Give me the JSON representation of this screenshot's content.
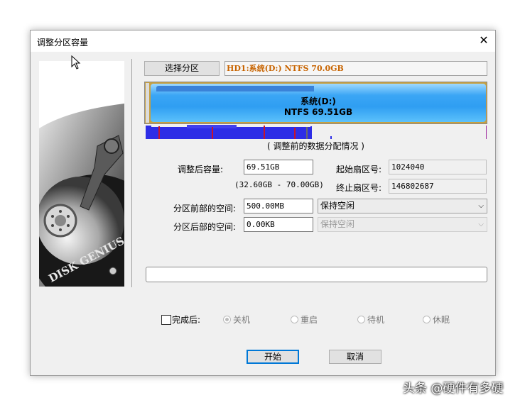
{
  "dialog": {
    "title": "调整分区容量",
    "close_glyph": "✕"
  },
  "side_panel": {
    "logo_text": "DISK GENIUS"
  },
  "partition": {
    "select_button": "选择分区",
    "info": "HD1:系统(D:) NTFS 70.0GB",
    "bar_line1": "系统(D:)",
    "bar_line2": "NTFS 69.51GB",
    "bar_color": "#3ba6f5",
    "distribution_caption": "( 调整前的数据分配情况 )",
    "distribution_color": "#2d2de6"
  },
  "form": {
    "new_size_label": "调整后容量:",
    "new_size_value": "69.51GB",
    "range_text": "(32.60GB - 70.00GB)",
    "start_sector_label": "起始扇区号:",
    "start_sector_value": "1024040",
    "end_sector_label": "终止扇区号:",
    "end_sector_value": "146802687",
    "front_space_label": "分区前部的空间:",
    "front_space_value": "500.00MB",
    "front_space_option": "保持空闲",
    "back_space_label": "分区后部的空间:",
    "back_space_value": "0.00KB",
    "back_space_option": "保持空闲"
  },
  "completion": {
    "label": "完成后:",
    "checked": false,
    "options": [
      "关机",
      "重启",
      "待机",
      "休眠"
    ],
    "selected": "关机"
  },
  "buttons": {
    "start": "开始",
    "cancel": "取消"
  },
  "watermark": "头条 @硬件有多硬"
}
